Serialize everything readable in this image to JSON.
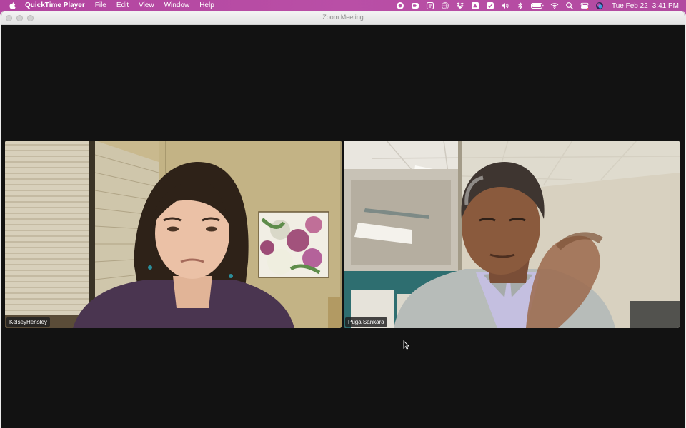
{
  "menubar": {
    "app_name": "QuickTime Player",
    "menus": [
      "File",
      "Edit",
      "View",
      "Window",
      "Help"
    ],
    "status_icons": [
      "record-icon",
      "zoom-icon",
      "app-icon",
      "globe-icon",
      "dropbox-icon",
      "drive-icon",
      "checkmark-icon",
      "volume-icon",
      "bluetooth-icon",
      "battery-icon",
      "wifi-icon",
      "search-icon",
      "control-center-icon",
      "siri-icon"
    ],
    "date": "Tue Feb 22",
    "time": "3:41 PM"
  },
  "window": {
    "title": "Zoom Meeting"
  },
  "participants": [
    {
      "name": "KelseyHensley"
    },
    {
      "name": "Puga Sankara"
    }
  ],
  "colors": {
    "menubar_bg": "#b84fa5",
    "stage_bg": "#121212",
    "titlebar_bg": "#ececec"
  }
}
